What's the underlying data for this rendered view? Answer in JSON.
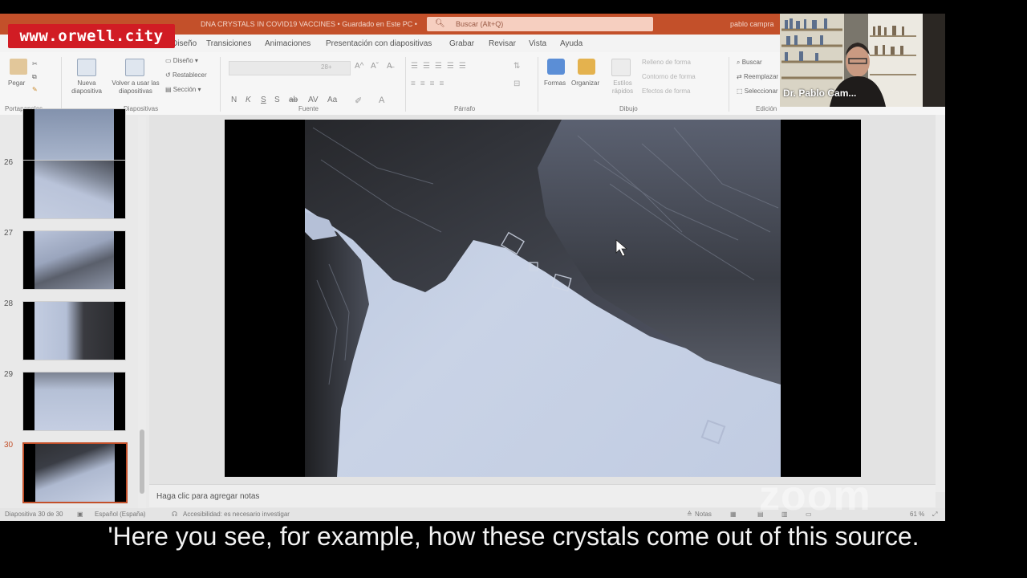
{
  "watermark": {
    "site_logo": "www.orwell.city",
    "zoom": "zoom"
  },
  "window": {
    "document_title": "DNA CRYSTALS IN COVID19 VACCINES • Guardado en Este PC •",
    "search_placeholder": "Buscar (Alt+Q)",
    "user": "pablo campra"
  },
  "ribbon": {
    "tabs": [
      "Diseño",
      "Transiciones",
      "Animaciones",
      "Presentación con diapositivas",
      "Grabar",
      "Revisar",
      "Vista",
      "Ayuda"
    ],
    "groups": [
      "Portapapeles",
      "Diapositivas",
      "Fuente",
      "Párrafo",
      "Dibujo",
      "Edición"
    ],
    "paste_label": "Pegar",
    "new_slide_label": "Nueva diapositiva",
    "reuse_label": "Volver a usar las diapositivas",
    "design_label": "Diseño",
    "reset_label": "Restablecer",
    "section_label": "Sección",
    "shapes_label": "Formas",
    "arrange_label": "Organizar",
    "quick_styles_label": "Estilos rápidos",
    "fill_label": "Relleno de forma",
    "outline_label": "Contorno de forma",
    "effects_label": "Efectos de forma",
    "find_label": "Buscar",
    "replace_label": "Reemplazar",
    "select_label": "Seleccionar",
    "font_size": "28+",
    "format_buttons": [
      "N",
      "K",
      "S",
      "S",
      "ab",
      "AV",
      "Aa"
    ]
  },
  "slides_panel": {
    "slides": [
      {
        "num": "26"
      },
      {
        "num": "27"
      },
      {
        "num": "28"
      },
      {
        "num": "29"
      },
      {
        "num": "30",
        "selected": true
      }
    ]
  },
  "notes_placeholder": "Haga clic para agregar notas",
  "status_bar": {
    "slide_count": "Diapositiva 30 de 30",
    "language": "Español (España)",
    "accessibility": "Accesibilidad: es necesario investigar",
    "notes": "Notas",
    "zoom": "61 %"
  },
  "webcam": {
    "name": "Dr. Pablo Cam..."
  },
  "subtitle": "'Here you see, for example, how these crystals come out of this source."
}
